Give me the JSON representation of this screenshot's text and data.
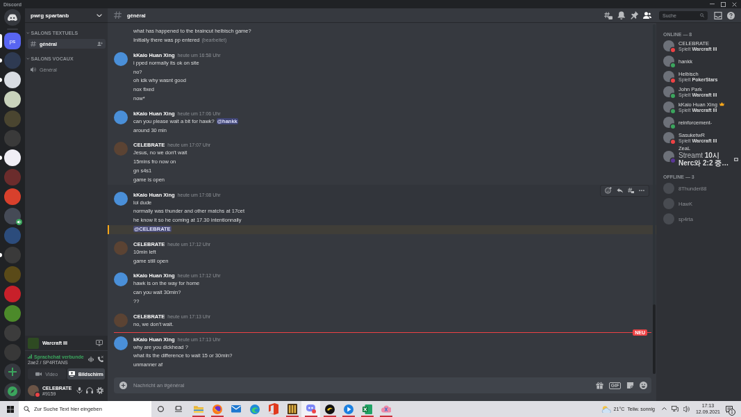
{
  "window": {
    "title": "Discord"
  },
  "servers": [
    {
      "kind": "home",
      "selected": false,
      "unread": false,
      "in_voice": false
    },
    {
      "kind": "text",
      "label": "ps",
      "selected": true,
      "unread": false,
      "in_voice": false
    },
    {
      "kind": "picture",
      "color": "#2e3a52",
      "selected": false,
      "unread": true,
      "in_voice": false
    },
    {
      "kind": "picture",
      "color": "#d8dce2",
      "selected": false,
      "unread": true,
      "in_voice": false
    },
    {
      "kind": "picture",
      "color": "#c9d3bc",
      "selected": false,
      "unread": false,
      "in_voice": false
    },
    {
      "kind": "picture",
      "color": "#4a4530",
      "selected": false,
      "unread": false,
      "in_voice": false
    },
    {
      "kind": "picture",
      "color": "#3a3a3a",
      "selected": false,
      "unread": false,
      "in_voice": false
    },
    {
      "kind": "picture",
      "color": "#f0eef5",
      "selected": false,
      "unread": true,
      "in_voice": false
    },
    {
      "kind": "picture",
      "color": "#6b2c2c",
      "selected": false,
      "unread": false,
      "in_voice": false
    },
    {
      "kind": "picture",
      "color": "#d8402c",
      "selected": false,
      "unread": false,
      "in_voice": false
    },
    {
      "kind": "picture",
      "color": "#454a56",
      "selected": false,
      "unread": false,
      "in_voice": true
    },
    {
      "kind": "picture",
      "color": "#2c4c7c",
      "selected": false,
      "unread": false,
      "in_voice": false
    },
    {
      "kind": "picture",
      "color": "#3a3a3a",
      "selected": false,
      "unread": true,
      "in_voice": false
    },
    {
      "kind": "picture",
      "color": "#5a4a18",
      "selected": false,
      "unread": false,
      "in_voice": false
    },
    {
      "kind": "picture",
      "color": "#c8202a",
      "selected": false,
      "unread": false,
      "in_voice": false
    },
    {
      "kind": "picture",
      "color": "#4c8a2a",
      "selected": false,
      "unread": false,
      "in_voice": false
    },
    {
      "kind": "picture",
      "color": "#3c3c3c",
      "selected": false,
      "unread": false,
      "in_voice": false
    },
    {
      "kind": "picture",
      "color": "#383838",
      "selected": false,
      "unread": false,
      "in_voice": false
    },
    {
      "kind": "add",
      "selected": false,
      "unread": false,
      "in_voice": false
    },
    {
      "kind": "explore",
      "selected": false,
      "unread": false,
      "in_voice": false
    }
  ],
  "server": {
    "name": "pwrg spartanb"
  },
  "categories": [
    {
      "name": "SALONS TEXTUELS",
      "expanded": true,
      "channels": [
        {
          "kind": "text",
          "name": "général",
          "selected": true
        }
      ]
    },
    {
      "name": "SALONS VOCAUX",
      "expanded": true,
      "channels": [
        {
          "kind": "voice",
          "name": "Général",
          "selected": false
        }
      ]
    }
  ],
  "activity": {
    "game": "Warcraft III"
  },
  "voice": {
    "status": "Sprachchat verbunde",
    "location": "2ae2 / SP4RTANS"
  },
  "media_buttons": [
    {
      "kind": "video",
      "label": "Video",
      "selected": false
    },
    {
      "kind": "screen",
      "label": "Bildschirm",
      "selected": true
    }
  ],
  "user": {
    "name": "CELEBRATE",
    "tag": "#9159",
    "color": "#ed4245"
  },
  "header": {
    "channel": "général",
    "search": {
      "placeholder": "Suche"
    }
  },
  "messages": [
    {
      "kind": "continuation",
      "hovered": false,
      "lines": [
        {
          "text": "what has happened to the braincut helbisch game?",
          "highlighted": false
        },
        {
          "text": "Initially there was pp entered",
          "edited": "(bearbeitet)",
          "highlighted": false
        }
      ]
    },
    {
      "kind": "group",
      "author": "kKaio Huan Xing",
      "time": "heute um 16:58 Uhr",
      "color": "#4a8fd8",
      "hovered": false,
      "lines": [
        {
          "text": "i pped normally its ok on site",
          "highlighted": false
        },
        {
          "text": "no?",
          "highlighted": false
        },
        {
          "text": "oh idk why wasnt good",
          "highlighted": false
        },
        {
          "text": "nox fixed",
          "highlighted": false
        },
        {
          "text": "now*",
          "highlighted": false
        }
      ]
    },
    {
      "kind": "group",
      "author": "kKaio Huan Xing",
      "time": "heute um 17:06 Uhr",
      "color": "#4a8fd8",
      "hovered": false,
      "lines": [
        {
          "text": "can you please wait a bit for hawk?",
          "mention": "@hankk",
          "highlighted": false
        },
        {
          "text": "around 30 min",
          "highlighted": false
        }
      ]
    },
    {
      "kind": "group",
      "author": "CELEBRATE",
      "time": "heute um 17:07 Uhr",
      "color": "#5b4333",
      "hovered": false,
      "lines": [
        {
          "text": "Jesus, no we don't wait",
          "highlighted": false
        },
        {
          "text": "15mins fro now on",
          "highlighted": false
        },
        {
          "text": "gn s4s1",
          "highlighted": false
        },
        {
          "text": "game is open",
          "highlighted": false
        }
      ]
    },
    {
      "kind": "group",
      "author": "kKaio Huan Xing",
      "time": "heute um 17:08 Uhr",
      "color": "#4a8fd8",
      "hovered": true,
      "lines": [
        {
          "text": "lol dude",
          "highlighted": false
        },
        {
          "text": "normally was thunder and other matchs at 17cet",
          "highlighted": false
        },
        {
          "text": "he know it so he coming at 17.30 intentionnally",
          "highlighted": false
        },
        {
          "mention": "@CELEBRATE",
          "highlighted": true
        }
      ]
    },
    {
      "kind": "group",
      "author": "CELEBRATE",
      "time": "heute um 17:12 Uhr",
      "color": "#5b4333",
      "hovered": false,
      "lines": [
        {
          "text": "10min left",
          "highlighted": false
        },
        {
          "text": "game still open",
          "highlighted": false
        }
      ]
    },
    {
      "kind": "group",
      "author": "kKaio Huan Xing",
      "time": "heute um 17:12 Uhr",
      "color": "#4a8fd8",
      "hovered": false,
      "lines": [
        {
          "text": "hawk is on the way for home",
          "highlighted": false
        },
        {
          "text": "can you wait 30min?",
          "highlighted": false
        },
        {
          "text": "??",
          "highlighted": false
        }
      ]
    },
    {
      "kind": "group",
      "author": "CELEBRATE",
      "time": "heute um 17:13 Uhr",
      "color": "#5b4333",
      "hovered": false,
      "lines": [
        {
          "text": "no, we don't wait.",
          "highlighted": false
        }
      ]
    },
    {
      "kind": "divider",
      "label": "NEU"
    },
    {
      "kind": "group",
      "author": "kKaio Huan Xing",
      "time": "heute um 17:13 Uhr",
      "color": "#4a8fd8",
      "hovered": false,
      "lines": [
        {
          "text": "why are you dickhead ?",
          "highlighted": false
        },
        {
          "text": "what its the difference to wait 15 or 30min?",
          "highlighted": false
        },
        {
          "text": "unmanner af",
          "highlighted": false
        }
      ]
    }
  ],
  "composer": {
    "placeholder": "Nachricht an #général",
    "gif_label": "GIF"
  },
  "members": [
    {
      "title": "ONLINE — 8",
      "members": [
        {
          "name": "CELEBRATE",
          "activity": "Spielt **Warcraft III**",
          "color": "#ed4245",
          "owner": false,
          "streaming": false,
          "offline": false
        },
        {
          "name": "hankk",
          "color": "#3ba55d",
          "owner": false,
          "streaming": false,
          "offline": false
        },
        {
          "name": "Helbisch",
          "activity": "Spielt **PokerStars**",
          "color": "#ed4245",
          "owner": false,
          "streaming": false,
          "offline": false
        },
        {
          "name": "John Park",
          "activity": "Spielt **Warcraft III**",
          "color": "#3ba55d",
          "owner": false,
          "streaming": false,
          "offline": false
        },
        {
          "name": "kKaio Huan Xing",
          "activity": "Spielt **Warcraft III**",
          "color": "#3ba55d",
          "owner": true,
          "streaming": false,
          "offline": false
        },
        {
          "name": "reinforcement-",
          "color": "#3ba55d",
          "owner": false,
          "streaming": false,
          "offline": false
        },
        {
          "name": "SasuketwR",
          "activity": "Spielt **Warcraft III**",
          "color": "#ed4245",
          "owner": false,
          "streaming": false,
          "offline": false
        },
        {
          "name": "ZeaL",
          "activity": "Streamt **10시 Nerc와 2:2 중…**",
          "color": "#593695",
          "owner": false,
          "streaming": true,
          "offline": false
        }
      ]
    },
    {
      "title": "OFFLINE — 3",
      "members": [
        {
          "name": "8Thunder88",
          "owner": false,
          "streaming": false,
          "offline": true
        },
        {
          "name": "HawK",
          "owner": false,
          "streaming": false,
          "offline": true
        },
        {
          "name": "sp4rta",
          "owner": false,
          "streaming": false,
          "offline": true
        }
      ]
    }
  ],
  "taskbar": {
    "search": {
      "placeholder": "Zur Suche Text hier eingeben"
    },
    "apps": [
      {
        "kind": "folder",
        "running": true,
        "active": false
      },
      {
        "kind": "fox",
        "running": true,
        "active": false
      },
      {
        "kind": "envelope",
        "running": false,
        "active": false
      },
      {
        "kind": "wave",
        "running": false,
        "active": false
      },
      {
        "kind": "document",
        "running": false,
        "active": false
      },
      {
        "kind": "tower",
        "running": true,
        "active": false
      },
      {
        "kind": "gamepad",
        "running": true,
        "active": true
      },
      {
        "kind": "swirl",
        "running": true,
        "active": false
      },
      {
        "kind": "play",
        "running": true,
        "active": false
      },
      {
        "kind": "spreadsheet",
        "running": true,
        "active": false
      },
      {
        "kind": "cloud",
        "running": true,
        "active": false
      }
    ],
    "weather": {
      "temperature": "21°C",
      "condition": "Teilw. sonnig"
    },
    "time": "17:13",
    "date": "12.09.2021",
    "notifications": "1"
  }
}
